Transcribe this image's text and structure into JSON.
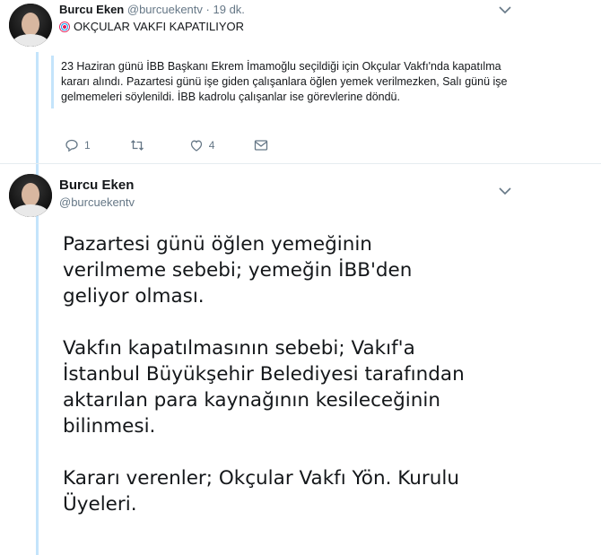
{
  "tweet1": {
    "author_name": "Burcu Eken",
    "handle": "@burcuekentv",
    "separator": "·",
    "time": "19 dk.",
    "subject": "OKÇULAR VAKFI KAPATILIYOR",
    "body": "23 Haziran günü İBB Başkanı Ekrem İmamoğlu seçildiği için Okçular Vakfı'nda kapatılma kararı alındı. Pazartesi günü işe giden çalışanlara öğlen yemek verilmezken, Salı günü işe gelmemeleri söylenildi. İBB kadrolu çalışanlar ise görevlerine döndü.",
    "reply_count": "1",
    "retweet_count": "",
    "like_count": "4"
  },
  "tweet2": {
    "author_name": "Burcu Eken",
    "handle": "@burcuekentv",
    "paragraphs": [
      "Pazartesi günü öğlen yemeğinin\nverilmeme sebebi; yemeğin İBB'den\ngeliyor olması.",
      "Vakfın kapatılmasının sebebi; Vakıf'a\nİstanbul Büyükşehir Belediyesi tarafından\naktarılan para kaynağının kesileceğinin\nbilinmesi.",
      "Kararı verenler; Okçular Vakfı Yön. Kurulu\nÜyeleri."
    ]
  },
  "icons": {
    "reply": "reply-icon",
    "retweet": "retweet-icon",
    "like": "heart-icon",
    "message": "envelope-icon",
    "menu": "chevron-down-icon",
    "emoji": "target-emoji-icon"
  },
  "colors": {
    "thread_line": "#c4e4fb",
    "muted": "#657786",
    "text": "#14171a"
  }
}
